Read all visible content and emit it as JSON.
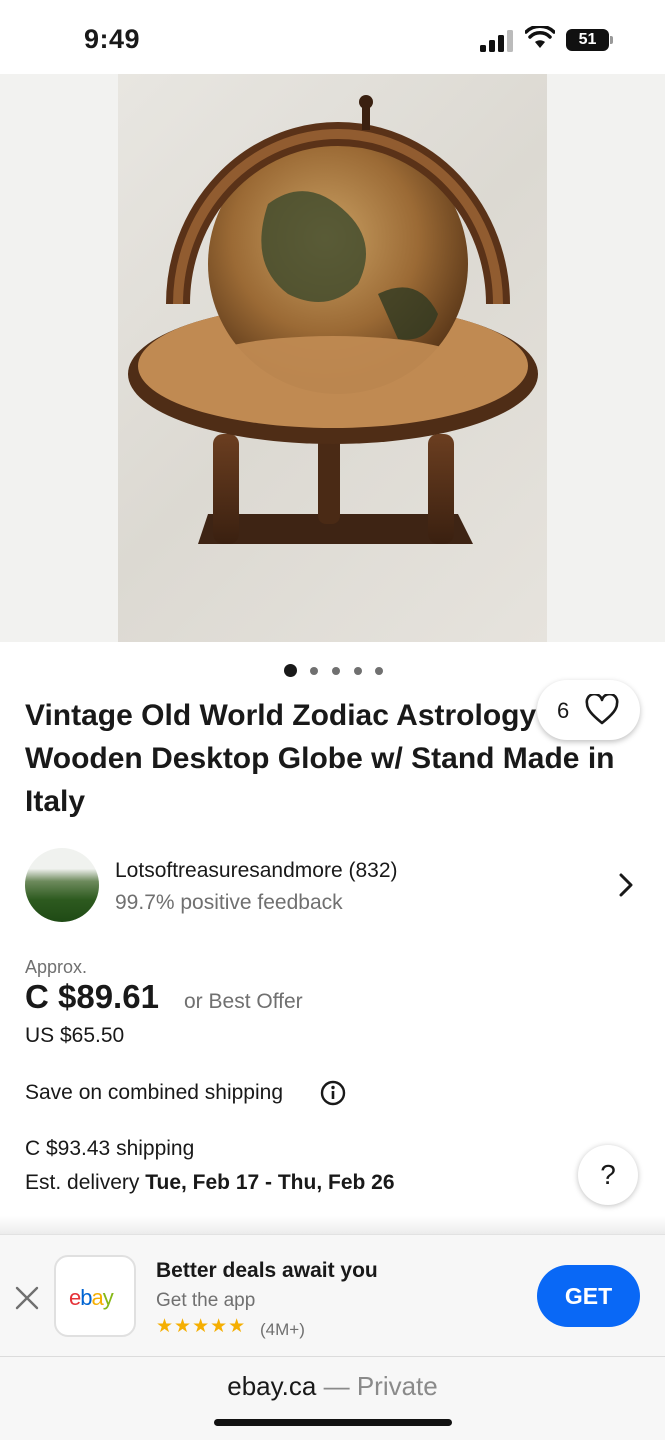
{
  "status_bar": {
    "time": "9:49",
    "battery": "51"
  },
  "gallery": {
    "watch_count": "6",
    "image_count": 5,
    "active_index": 0
  },
  "listing": {
    "title": "Vintage Old World Zodiac Astrology Wooden Desktop Globe w/ Stand Made in Italy",
    "seller": {
      "name": "Lotsoftreasuresandmore (832)",
      "feedback": "99.7% positive feedback"
    },
    "approx_label": "Approx.",
    "price": "C $89.61",
    "best_offer": "or Best Offer",
    "usd_price": "US $65.50",
    "combined_shipping": "Save on combined shipping",
    "shipping": "C $93.43 shipping",
    "delivery_prefix": "Est. delivery ",
    "delivery_dates": "Tue, Feb 17 - Thu, Feb 26",
    "help_label": "?"
  },
  "app_banner": {
    "title": "Better deals await you",
    "subtitle": "Get the app",
    "stars": "★★★★★",
    "rating_count": "(4M+)",
    "get_label": "GET",
    "logo": [
      "e",
      "b",
      "a",
      "y"
    ],
    "logo_colors": [
      "#e53238",
      "#0064d2",
      "#f5af02",
      "#86b817"
    ]
  },
  "url_bar": {
    "domain": "ebay.ca",
    "mode": " — Private"
  },
  "colors": {
    "accent": "#0968f6",
    "star": "#f5af02",
    "muted": "#707070"
  }
}
